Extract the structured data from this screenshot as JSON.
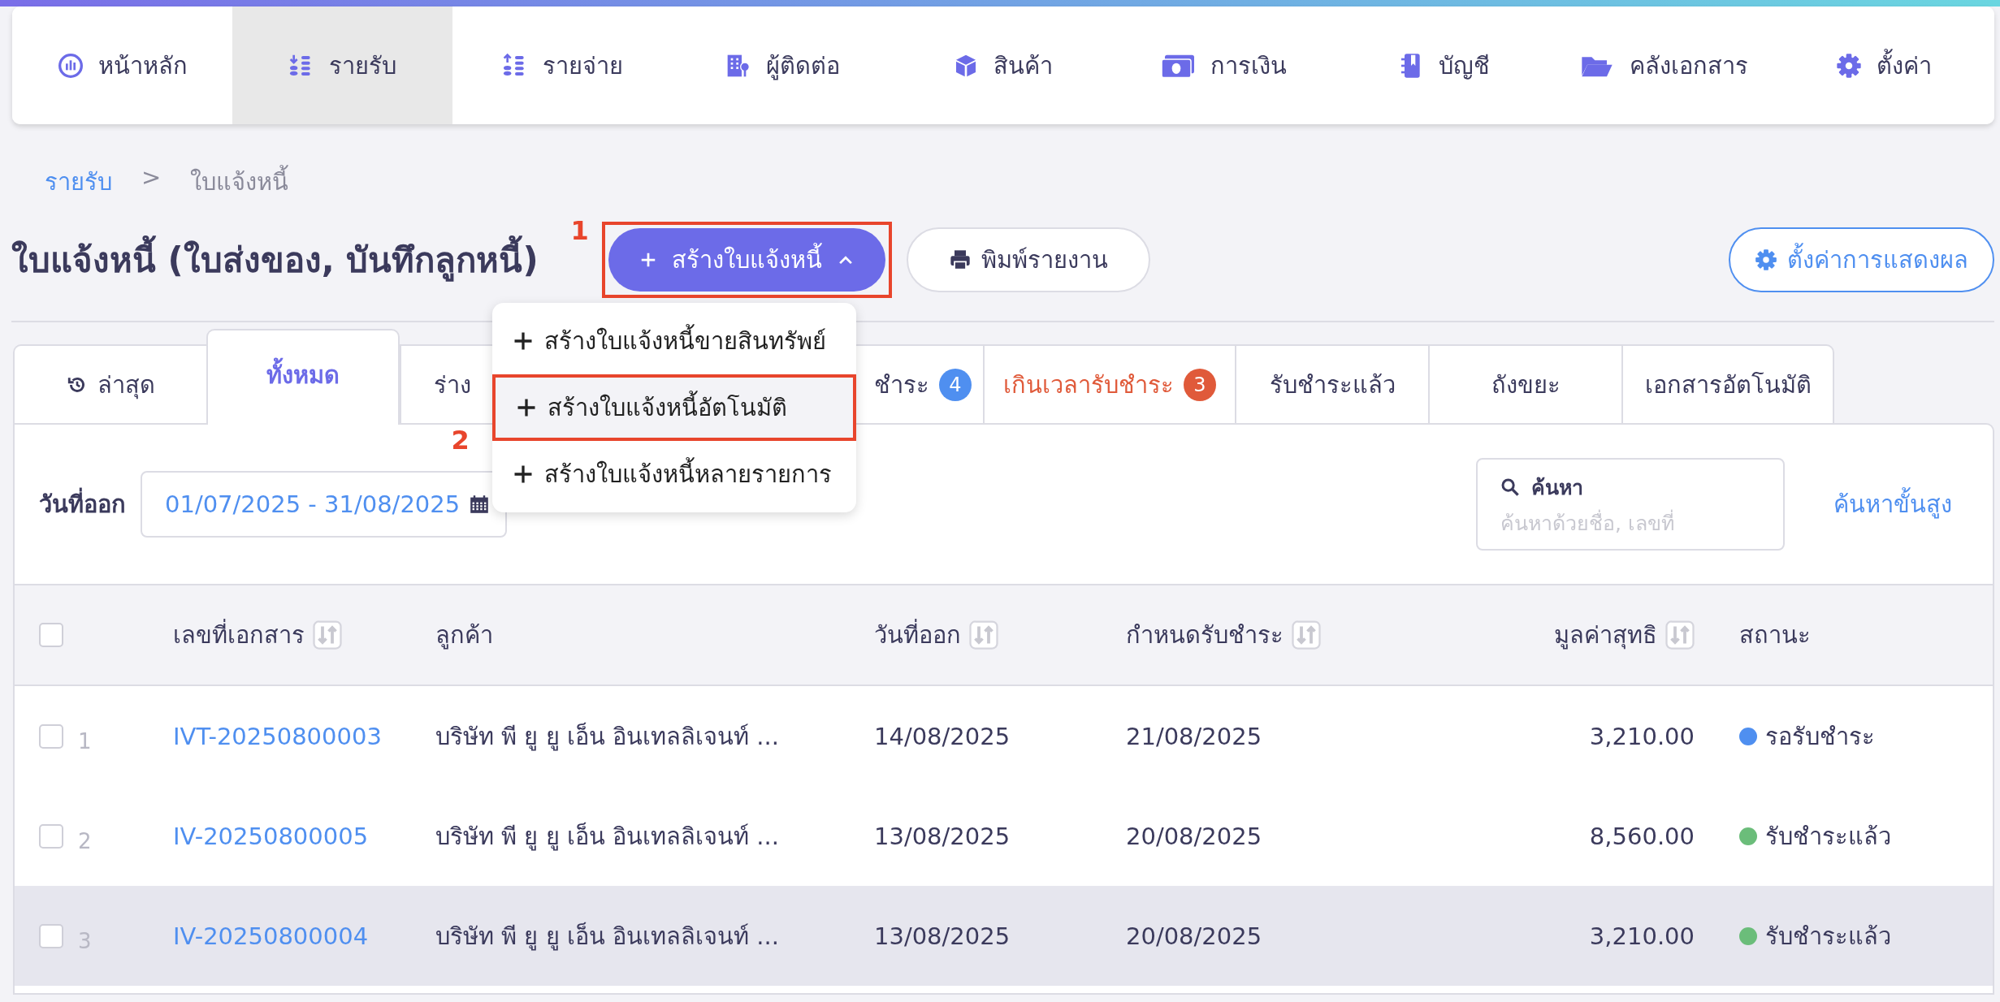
{
  "nav": [
    {
      "label": "หน้าหลัก",
      "kind": "dashboard",
      "selected": false
    },
    {
      "label": "รายรับ",
      "kind": "income",
      "selected": true
    },
    {
      "label": "รายจ่าย",
      "kind": "expense",
      "selected": false
    },
    {
      "label": "ผู้ติดต่อ",
      "kind": "contacts",
      "selected": false
    },
    {
      "label": "สินค้า",
      "kind": "products",
      "selected": false
    },
    {
      "label": "การเงิน",
      "kind": "finance",
      "selected": false
    },
    {
      "label": "บัญชี",
      "kind": "accounting",
      "selected": false
    },
    {
      "label": "คลังเอกสาร",
      "kind": "documents",
      "selected": false
    },
    {
      "label": "ตั้งค่า",
      "kind": "settings",
      "selected": false
    }
  ],
  "breadcrumb": [
    {
      "label": "รายรับ",
      "kind": "link"
    },
    {
      "label": ">",
      "kind": "separator"
    },
    {
      "label": "ใบแจ้งหนี้",
      "kind": "current"
    }
  ],
  "page_title": "ใบแจ้งหนี้ (ใบส่งของ, บันทึกลูกหนี้)",
  "annotations": [
    "1",
    "2"
  ],
  "create_button": {
    "label": "สร้างใบแจ้งหนี้",
    "expanded": true
  },
  "print_button": "พิมพ์รายงาน",
  "display_settings_button": "ตั้งค่าการแสดงผล",
  "create_menu": [
    {
      "label": "สร้างใบแจ้งหนี้ขายสินทรัพย์",
      "selected": false
    },
    {
      "label": "สร้างใบแจ้งหนี้อัตโนมัติ",
      "selected": true
    },
    {
      "label": "สร้างใบแจ้งหนี้หลายรายการ",
      "selected": false
    }
  ],
  "tabs": [
    {
      "label": "ล่าสุด",
      "kind": "history",
      "selected": false
    },
    {
      "label": "ทั้งหมด",
      "kind": "plain",
      "selected": true
    },
    {
      "label": "ร่าง",
      "kind": "covered_left",
      "selected": false
    },
    {
      "label": "ชำระ",
      "kind": "covered_right",
      "badge": "4",
      "color": "#4f8ff0",
      "selected": false
    },
    {
      "label": "เกินเวลารับชำระ",
      "kind": "alert",
      "badge": "3",
      "color": "#e05a3a",
      "selected": false
    },
    {
      "label": "รับชำระแล้ว",
      "kind": "plain",
      "selected": false
    },
    {
      "label": "ถังขยะ",
      "kind": "plain",
      "selected": false
    },
    {
      "label": "เอกสารอัตโนมัติ",
      "kind": "plain",
      "selected": false
    }
  ],
  "filters": {
    "date_label": "วันที่ออก",
    "date_range": "01/07/2025 - 31/08/2025",
    "search_label": "ค้นหา",
    "search_placeholder": "ค้นหาด้วยชื่อ, เลขที่",
    "advanced_search": "ค้นหาขั้นสูง"
  },
  "table": {
    "select_all_checked": false,
    "columns": [
      {
        "label": "เลขที่เอกสาร",
        "sortable": true
      },
      {
        "label": "ลูกค้า",
        "sortable": false
      },
      {
        "label": "วันที่ออก",
        "sortable": true
      },
      {
        "label": "กำหนดรับชำระ",
        "sortable": true
      },
      {
        "label": "มูลค่าสุทธิ",
        "sortable": true
      },
      {
        "label": "สถานะ",
        "sortable": false
      }
    ],
    "rows": [
      {
        "number": "1",
        "doc_no": "IVT-20250800003",
        "customer": "บริษัท พี ยู ยู เอ็น อินเทลลิเจนท์ ...",
        "issue_date": "14/08/2025",
        "due_date": "21/08/2025",
        "amount": "3,210.00",
        "status": "รอรับชำระ",
        "color": "#4f8ff0",
        "checked": false,
        "highlighted": false
      },
      {
        "number": "2",
        "doc_no": "IV-20250800005",
        "customer": "บริษัท พี ยู ยู เอ็น อินเทลลิเจนท์ ...",
        "issue_date": "13/08/2025",
        "due_date": "20/08/2025",
        "amount": "8,560.00",
        "status": "รับชำระแล้ว",
        "color": "#6bbd7a",
        "checked": false,
        "highlighted": false
      },
      {
        "number": "3",
        "doc_no": "IV-20250800004",
        "customer": "บริษัท พี ยู ยู เอ็น อินเทลลิเจนท์ ...",
        "issue_date": "13/08/2025",
        "due_date": "20/08/2025",
        "amount": "3,210.00",
        "status": "รับชำระแล้ว",
        "color": "#6bbd7a",
        "checked": false,
        "highlighted": true
      }
    ]
  }
}
